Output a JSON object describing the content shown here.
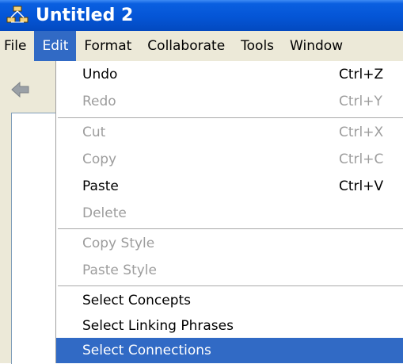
{
  "window": {
    "title": "Untitled 2",
    "app_icon": "concept-map-icon"
  },
  "menubar": {
    "items": [
      "File",
      "Edit",
      "Format",
      "Collaborate",
      "Tools",
      "Window"
    ],
    "active": "Edit"
  },
  "toolbar": {
    "back_icon": "back-arrow-icon"
  },
  "edit_menu": {
    "items": [
      {
        "label": "Undo",
        "shortcut": "Ctrl+Z",
        "state": "enabled"
      },
      {
        "label": "Redo",
        "shortcut": "Ctrl+Y",
        "state": "disabled"
      },
      {
        "label": "Cut",
        "shortcut": "Ctrl+X",
        "state": "disabled"
      },
      {
        "label": "Copy",
        "shortcut": "Ctrl+C",
        "state": "disabled"
      },
      {
        "label": "Paste",
        "shortcut": "Ctrl+V",
        "state": "enabled"
      },
      {
        "label": "Delete",
        "shortcut": "",
        "state": "disabled"
      },
      {
        "label": "Copy Style",
        "shortcut": "",
        "state": "disabled"
      },
      {
        "label": "Paste Style",
        "shortcut": "",
        "state": "disabled"
      },
      {
        "label": "Select Concepts",
        "shortcut": "",
        "state": "enabled"
      },
      {
        "label": "Select Linking Phrases",
        "shortcut": "",
        "state": "enabled"
      },
      {
        "label": "Select Connections",
        "shortcut": "",
        "state": "selected"
      }
    ]
  },
  "colors": {
    "titlebar": "#0455d6",
    "menu_highlight": "#316ac5",
    "chrome": "#ece9d8",
    "disabled_text": "#9d9d9d"
  }
}
